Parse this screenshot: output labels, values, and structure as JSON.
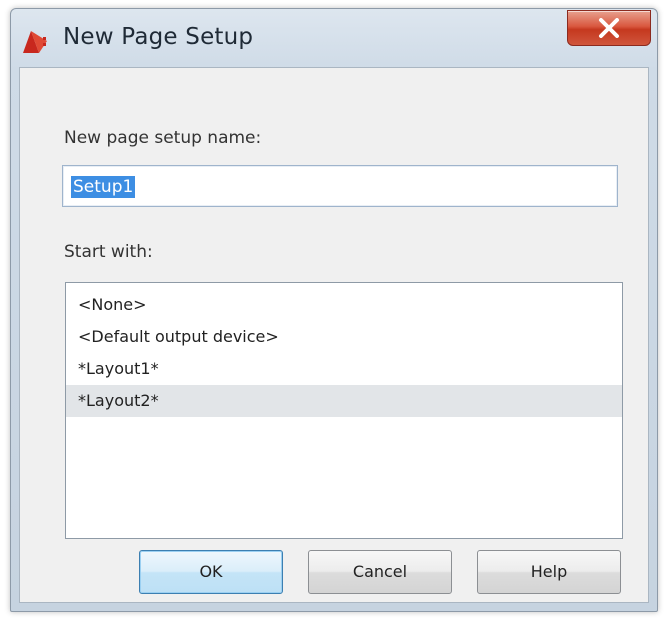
{
  "window": {
    "title": "New Page Setup",
    "close_glyph": "x"
  },
  "form": {
    "name_label": "New page setup name:",
    "name_value": "Setup1",
    "start_label": "Start with:"
  },
  "list": {
    "items": [
      "<None>",
      "<Default output device>",
      "*Layout1*",
      "*Layout2*"
    ],
    "selected_index": 3
  },
  "buttons": {
    "ok": "OK",
    "cancel": "Cancel",
    "help": "Help"
  },
  "colors": {
    "selection_highlight": "#3d8ee3",
    "close_button": "#d0563c",
    "app_icon": "#c8281e"
  },
  "icons": {
    "app": "autocad-app-icon",
    "close": "close-icon"
  }
}
